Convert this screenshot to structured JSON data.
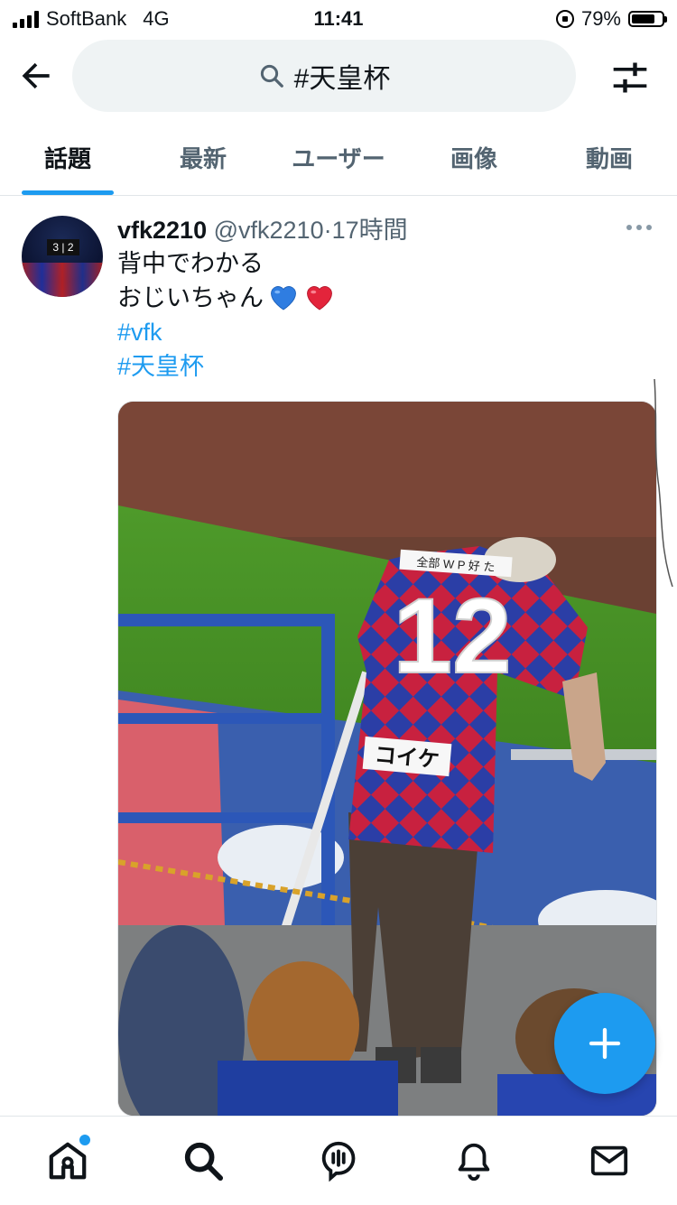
{
  "status_bar": {
    "carrier": "SoftBank",
    "network": "4G",
    "time": "11:41",
    "battery": "79%",
    "battery_level": 0.79
  },
  "search": {
    "query": "#天皇杯",
    "back_icon": "arrow-left-icon",
    "filter_icon": "sliders-icon"
  },
  "tabs": [
    {
      "label": "話題",
      "active": true
    },
    {
      "label": "最新",
      "active": false
    },
    {
      "label": "ユーザー",
      "active": false
    },
    {
      "label": "画像",
      "active": false
    },
    {
      "label": "動画",
      "active": false
    }
  ],
  "tweet": {
    "display_name": "vfk2210",
    "handle": "@vfk2210",
    "separator": "·",
    "time": "17時間",
    "line1": "背中でわかる",
    "line2": "おじいちゃん",
    "emojis": [
      "blue-heart",
      "red-heart"
    ],
    "hashtags": [
      "#vfk",
      "#天皇杯"
    ],
    "avatar_score": "3 | 2",
    "media": {
      "jersey_number": "12",
      "name_tag": "コイケ",
      "sponsor_text": "全部 W P 好 た"
    }
  },
  "colors": {
    "accent": "#1d9bf0",
    "text": "#0f1419",
    "muted": "#536471",
    "jersey_red": "#c8213f",
    "jersey_blue": "#2b3ea6"
  },
  "bottom_nav": [
    {
      "icon": "home-icon",
      "has_notification_dot": true
    },
    {
      "icon": "search-icon"
    },
    {
      "icon": "spaces-icon"
    },
    {
      "icon": "bell-icon"
    },
    {
      "icon": "mail-icon"
    }
  ],
  "fab": {
    "icon": "plus-icon"
  }
}
